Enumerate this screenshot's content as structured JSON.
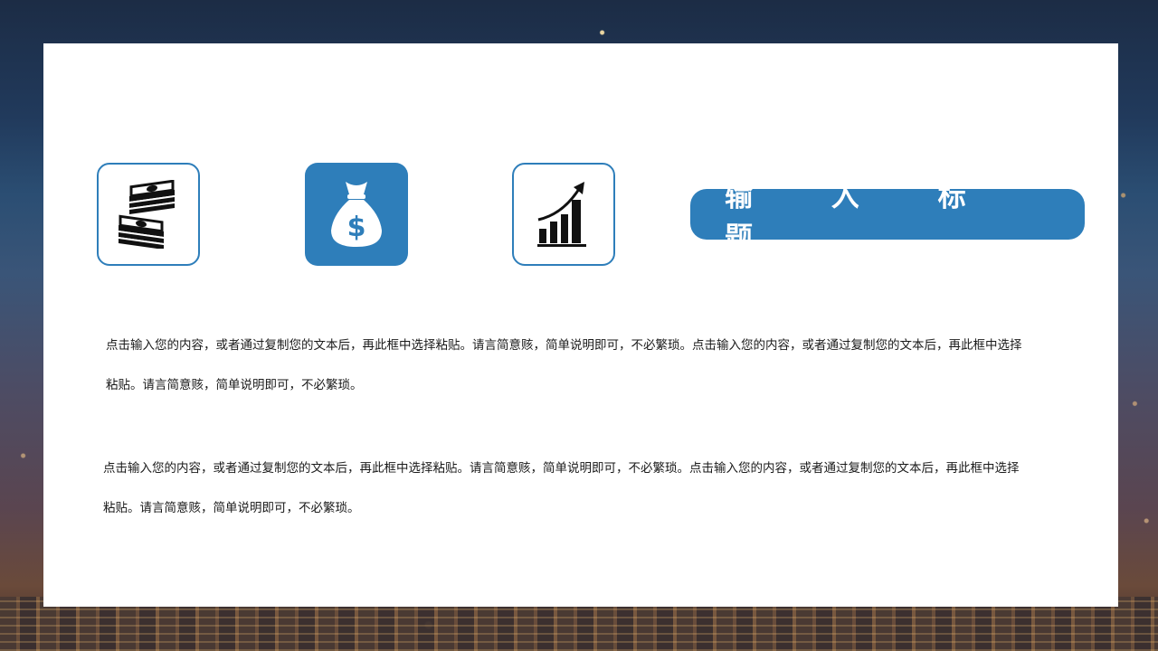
{
  "slide": {
    "title": "输 入 标 题",
    "paragraphs": [
      "点击输入您的内容，或者通过复制您的文本后，再此框中选择粘贴。请言简意赅，简单说明即可，不必繁琐。点击输入您的内容，或者通过复制您的文本后，再此框中选择粘贴。请言简意赅，简单说明即可，不必繁琐。",
      "点击输入您的内容，或者通过复制您的文本后，再此框中选择粘贴。请言简意赅，简单说明即可，不必繁琐。点击输入您的内容，或者通过复制您的文本后，再此框中选择粘贴。请言简意赅，简单说明即可，不必繁琐。"
    ],
    "icons": [
      {
        "name": "cash-stack-icon",
        "style": "outline"
      },
      {
        "name": "money-bag-icon",
        "style": "filled"
      },
      {
        "name": "growth-chart-icon",
        "style": "outline"
      }
    ],
    "colors": {
      "accent": "#2e7eba",
      "panel": "#ffffff",
      "text": "#1a1a1a",
      "icon": "#111111"
    }
  }
}
